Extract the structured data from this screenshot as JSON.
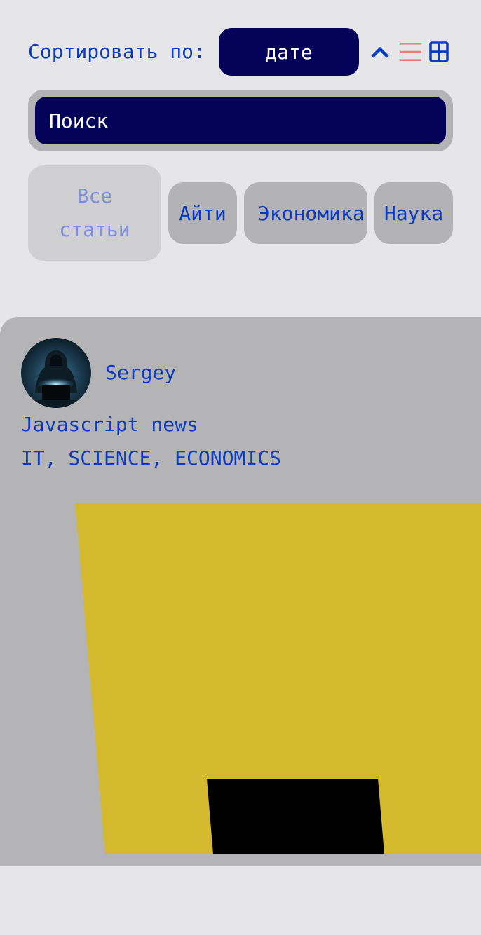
{
  "sort": {
    "label": "Сортировать по:",
    "selected": "дате"
  },
  "colors": {
    "accent": "#0b3bbf",
    "dark": "#05025a",
    "list_view_icon": "#f07b7b",
    "image_yellow": "#d4b92e"
  },
  "icons": {
    "order": "chevron-up-icon",
    "list_view": "list-view-icon",
    "grid_view": "grid-view-icon"
  },
  "search": {
    "placeholder": "Поиск"
  },
  "tabs": [
    {
      "label": "Все статьи",
      "active": true
    },
    {
      "label": "Айти",
      "active": false
    },
    {
      "label": "Экономика",
      "active": false
    },
    {
      "label": "Наука",
      "active": false
    }
  ],
  "article": {
    "author": "Sergey",
    "title": "Javascript news",
    "types": "IT, SCIENCE, ECONOMICS"
  }
}
